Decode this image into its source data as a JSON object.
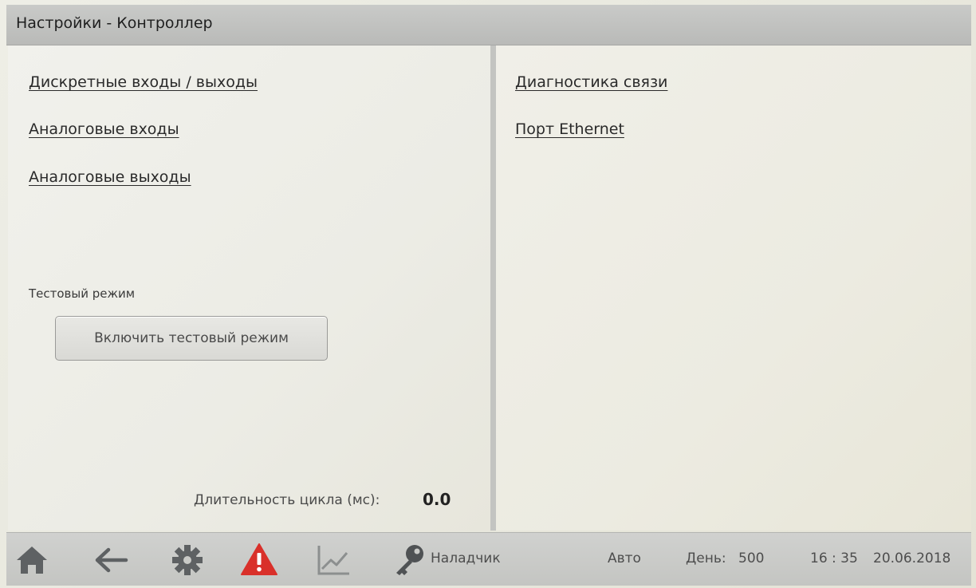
{
  "window": {
    "title": "Настройки - Контроллер"
  },
  "left_panel": {
    "links": [
      {
        "label": "Дискретные входы / выходы"
      },
      {
        "label": "Аналоговые входы"
      },
      {
        "label": "Аналоговые выходы"
      }
    ],
    "test_mode": {
      "section_label": "Тестовый режим",
      "button_label": "Включить тестовый режим"
    },
    "cycle": {
      "label": "Длительность цикла (мс):",
      "value": "0.0"
    }
  },
  "right_panel": {
    "links": [
      {
        "label": "Диагностика связи"
      },
      {
        "label": "Порт Ethernet"
      }
    ]
  },
  "bottom_bar": {
    "icons": [
      "home-icon",
      "back-arrow-icon",
      "gear-icon",
      "warning-icon",
      "chart-icon",
      "key-icon"
    ],
    "user_role": "Наладчик",
    "mode": "Авто",
    "day_label": "День:",
    "day_value": "500",
    "time": "16 : 35",
    "date": "20.06.2018"
  },
  "colors": {
    "warning": "#d9302a",
    "icon_gray": "#5e6163",
    "chart_icon": "#8c8f8f"
  }
}
